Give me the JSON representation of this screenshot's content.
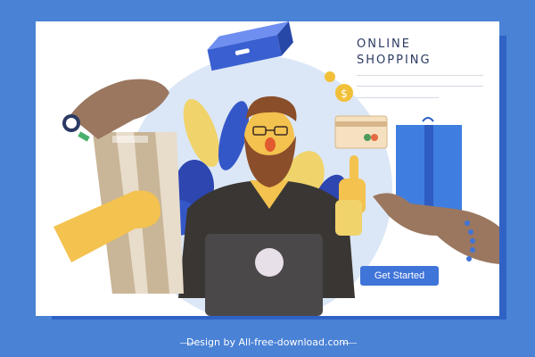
{
  "banner": {
    "heading_line1": "ONLINE",
    "heading_line2": "SHOPPING",
    "cta_label": "Get Started"
  },
  "footer": {
    "credit": "Design by All-free-download.com"
  },
  "colors": {
    "background": "#4a82d6",
    "card": "#ffffff",
    "accent_blue": "#3f74d8",
    "heading": "#2b3a63"
  },
  "icons": [
    "shopping-bag-icon",
    "parcel-box-icon",
    "credit-card-icon",
    "dollar-coin-icon",
    "laptop-icon",
    "wristwatch-icon",
    "bracelet-icon"
  ]
}
